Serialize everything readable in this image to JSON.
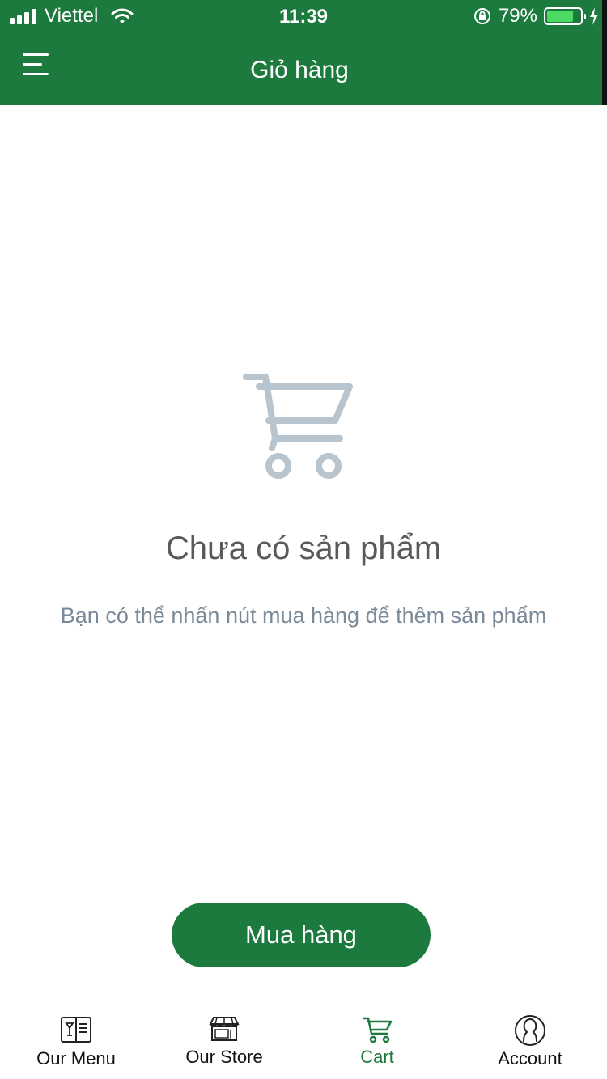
{
  "status_bar": {
    "carrier": "Viettel",
    "time": "11:39",
    "battery_percent": "79%",
    "battery_level": 0.79
  },
  "header": {
    "title": "Giỏ hàng",
    "menu_icon": "hamburger-menu-icon"
  },
  "empty_state": {
    "icon": "shopping-cart-icon",
    "title": "Chưa có sản phẩm",
    "subtitle": "Bạn có thể nhấn nút mua hàng để thêm sản phẩm"
  },
  "buy_button": {
    "label": "Mua hàng"
  },
  "tabs": [
    {
      "label": "Our Menu",
      "icon": "menu-book-icon",
      "active": false
    },
    {
      "label": "Our Store",
      "icon": "store-icon",
      "active": false
    },
    {
      "label": "Cart",
      "icon": "cart-icon",
      "active": true
    },
    {
      "label": "Account",
      "icon": "account-icon",
      "active": false
    }
  ],
  "colors": {
    "brand_green": "#1d7a3e",
    "icon_gray": "#b8c4ce",
    "subtitle_gray": "#7a8a99"
  }
}
